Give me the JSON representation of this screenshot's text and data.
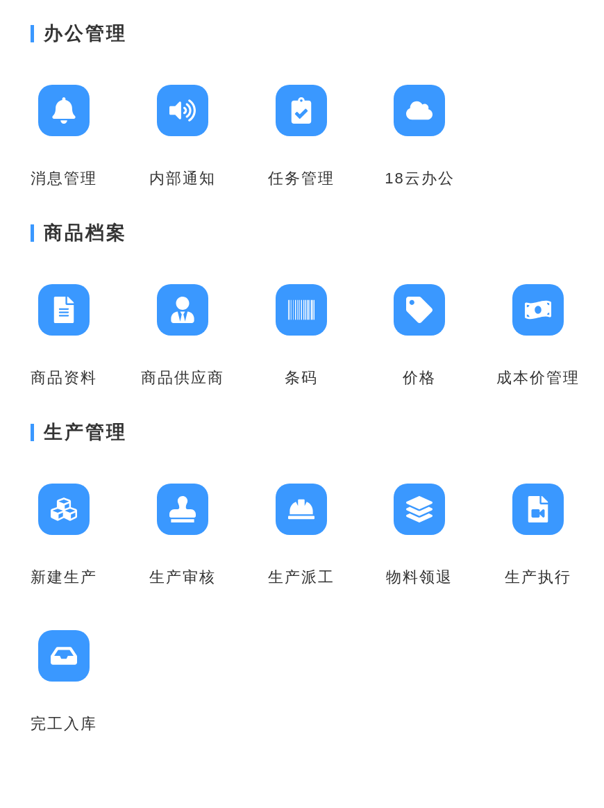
{
  "sections": [
    {
      "title": "办公管理",
      "items": [
        {
          "label": "消息管理"
        },
        {
          "label": "内部通知"
        },
        {
          "label": "任务管理"
        },
        {
          "label": "18云办公"
        }
      ]
    },
    {
      "title": "商品档案",
      "items": [
        {
          "label": "商品资料"
        },
        {
          "label": "商品供应商"
        },
        {
          "label": "条码"
        },
        {
          "label": "价格"
        },
        {
          "label": "成本价管理"
        }
      ]
    },
    {
      "title": "生产管理",
      "items": [
        {
          "label": "新建生产"
        },
        {
          "label": "生产审核"
        },
        {
          "label": "生产派工"
        },
        {
          "label": "物料领退"
        },
        {
          "label": "生产执行"
        },
        {
          "label": "完工入库"
        }
      ]
    }
  ]
}
